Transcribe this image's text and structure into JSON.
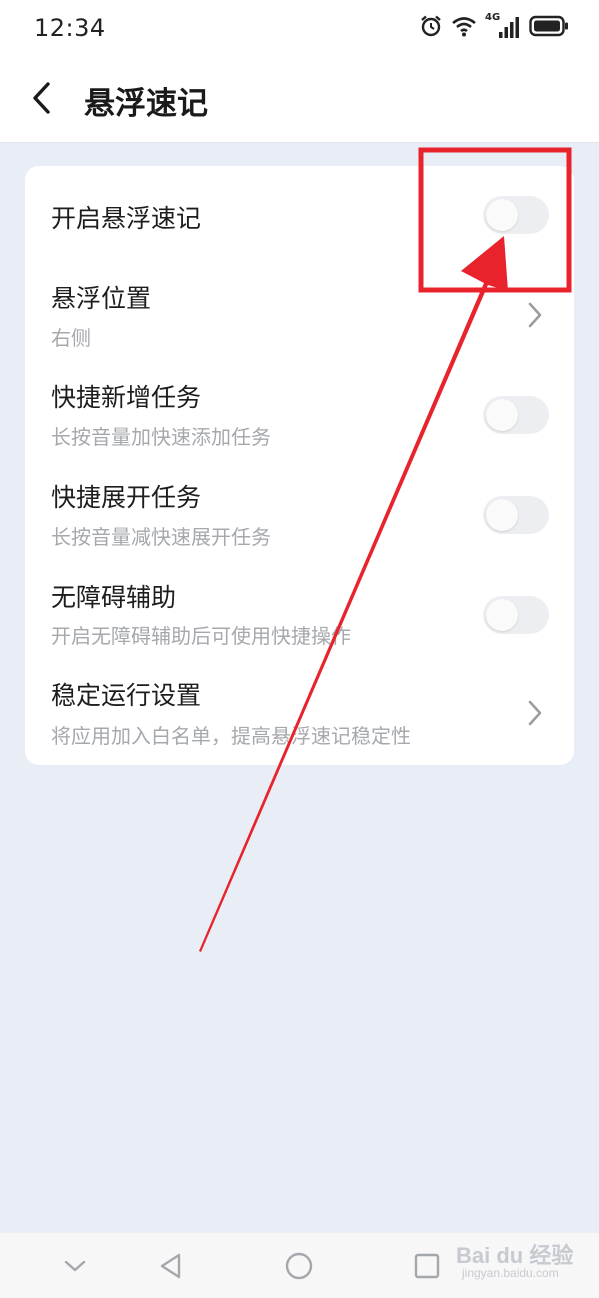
{
  "status_bar": {
    "time": "12:34",
    "network_label": "4G",
    "icons": [
      "alarm-icon",
      "wifi-icon",
      "signal-icon",
      "battery-icon"
    ]
  },
  "header": {
    "title": "悬浮速记",
    "back_icon": "back-arrow-icon"
  },
  "settings": {
    "items": [
      {
        "title": "开启悬浮速记",
        "subtitle": "",
        "control": "toggle",
        "enabled": false
      },
      {
        "title": "悬浮位置",
        "subtitle": "右侧",
        "control": "chevron"
      },
      {
        "title": "快捷新增任务",
        "subtitle": "长按音量加快速添加任务",
        "control": "toggle",
        "enabled": false
      },
      {
        "title": "快捷展开任务",
        "subtitle": "长按音量减快速展开任务",
        "control": "toggle",
        "enabled": false
      },
      {
        "title": "无障碍辅助",
        "subtitle": "开启无障碍辅助后可使用快捷操作",
        "control": "toggle",
        "enabled": false
      },
      {
        "title": "稳定运行设置",
        "subtitle": "将应用加入白名单，提高悬浮速记稳定性",
        "control": "chevron"
      }
    ]
  },
  "nav_bar": {
    "icons": [
      "collapse-down-icon",
      "back-triangle-icon",
      "home-circle-icon",
      "recents-square-icon"
    ]
  },
  "watermark": {
    "brand": "Bai du 经验",
    "url": "jingyan.baidu.com"
  },
  "colors": {
    "page_background": "#e9eef6",
    "card_background": "#ffffff",
    "toggle_off": "#eceef1",
    "annotation_red": "#e8232c",
    "subtitle_gray": "#a5a8ad"
  }
}
